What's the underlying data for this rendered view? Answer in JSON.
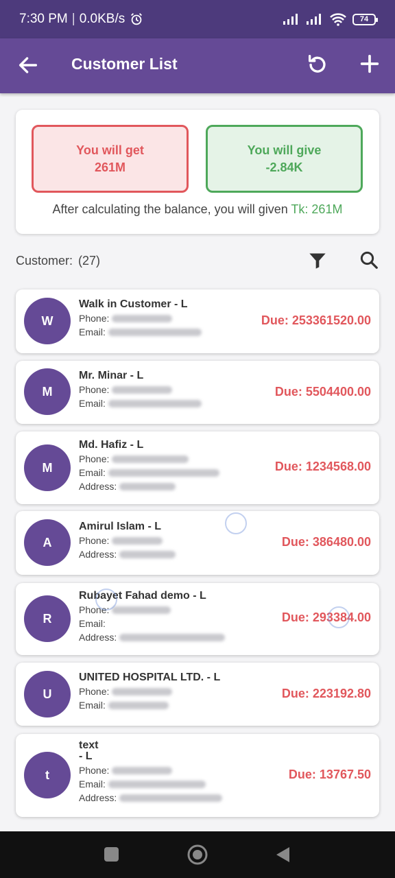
{
  "status_bar": {
    "time": "7:30 PM",
    "speed": "0.0KB/s",
    "battery": "74"
  },
  "app_bar": {
    "title": "Customer List"
  },
  "summary": {
    "get_label": "You will get",
    "get_value": "261M",
    "give_label": "You will give",
    "give_value": "-2.84K",
    "balance_text": "After calculating the balance, you will given",
    "balance_amount": "Tk: 261M"
  },
  "customers_header": {
    "label": "Customer:",
    "count": "(27)"
  },
  "labels": {
    "phone": "Phone:",
    "email": "Email:",
    "address": "Address:"
  },
  "customers": [
    {
      "initial": "W",
      "name": "Walk in Customer - L",
      "due": "Due: 253361520.00"
    },
    {
      "initial": "M",
      "name": "Mr. Minar - L",
      "due": "Due: 5504400.00"
    },
    {
      "initial": "M",
      "name": "Md. Hafiz - L",
      "due": "Due: 1234568.00"
    },
    {
      "initial": "A",
      "name": "Amirul Islam  - L",
      "due": "Due: 386480.00"
    },
    {
      "initial": "R",
      "name": "Rubayet Fahad demo - L",
      "due": "Due: 293384.00"
    },
    {
      "initial": "U",
      "name": "UNITED HOSPITAL LTD. - L",
      "due": "Due: 223192.80"
    },
    {
      "initial": "t",
      "name": "text\n - L",
      "due": "Due: 13767.50"
    }
  ],
  "colors": {
    "primary": "#654a96",
    "status": "#4d3a7c",
    "red": "#e1575c",
    "green": "#4ea85a"
  }
}
